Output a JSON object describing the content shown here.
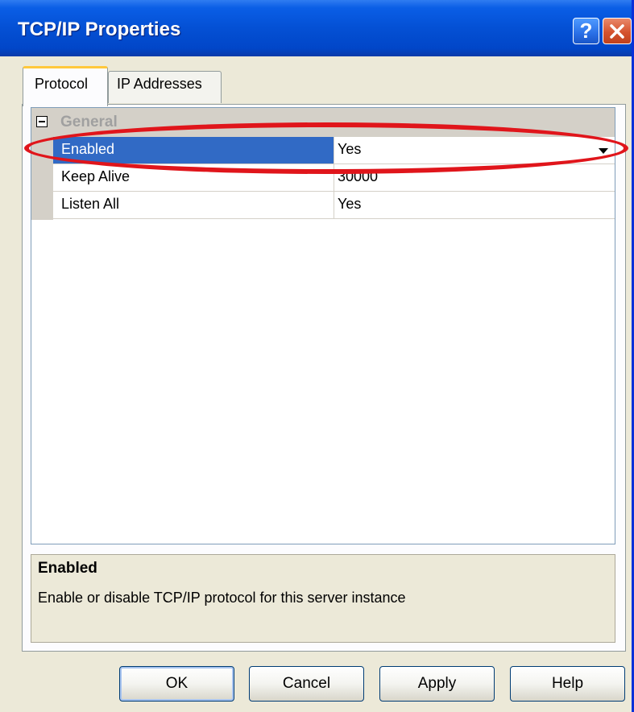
{
  "window": {
    "title": "TCP/IP Properties",
    "help_glyph": "?",
    "close_glyph": "✕"
  },
  "tabs": [
    {
      "label": "Protocol",
      "active": true
    },
    {
      "label": "IP Addresses",
      "active": false
    }
  ],
  "grid": {
    "category": "General",
    "rows": [
      {
        "name": "Enabled",
        "value": "Yes",
        "selected": true
      },
      {
        "name": "Keep Alive",
        "value": "30000",
        "selected": false
      },
      {
        "name": "Listen All",
        "value": "Yes",
        "selected": false
      }
    ]
  },
  "description": {
    "title": "Enabled",
    "text": "Enable or disable TCP/IP protocol for this server instance"
  },
  "buttons": {
    "ok": "OK",
    "cancel": "Cancel",
    "apply": "Apply",
    "help": "Help"
  },
  "colors": {
    "titlebar": "#0450d4",
    "selection": "#316ac5",
    "annotation": "#e0151b"
  }
}
